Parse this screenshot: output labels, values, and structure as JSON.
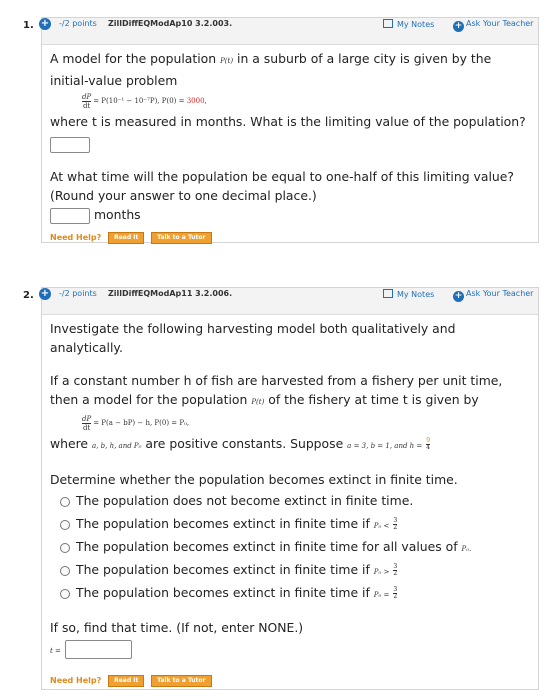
{
  "q1": {
    "number": "1.",
    "points": "-/2 points",
    "id": "ZillDiffEQModAp10 3.2.003.",
    "my_notes": "My Notes",
    "ask_teacher": "Ask Your Teacher",
    "intro_a": "A model for the population",
    "intro_pt": "P(t)",
    "intro_b": "in a suburb of a large city is given by the initial-value problem",
    "eq_num": "dP",
    "eq_den": "dt",
    "eq_body": "= P(10⁻¹ − 10⁻⁷P),   P(0) = ",
    "eq_initial": "3000",
    "eq_end": ",",
    "question1": "where t is measured in months. What is the limiting value of the population?",
    "question2": "At what time will the population be equal to one-half of this limiting value? (Round your answer to one decimal place.)",
    "unit": "months",
    "need_help": "Need Help?",
    "read_it": "Read It",
    "talk_tutor": "Talk to a Tutor"
  },
  "q2": {
    "number": "2.",
    "points": "-/2 points",
    "id": "ZillDiffEQModAp11 3.2.006.",
    "my_notes": "My Notes",
    "ask_teacher": "Ask Your Teacher",
    "intro": "Investigate the following harvesting model both qualitatively and analytically.",
    "para_a": "If a constant number h of fish are harvested from a fishery per unit time, then a model for the population",
    "para_pt": "P(t)",
    "para_b": "of the fishery at time t is given by",
    "eq_num": "dP",
    "eq_den": "dt",
    "eq_body": "= P(a − bP) − h,   P(0) = P₀,",
    "where_a": "where",
    "where_vars": "a, b, h, and P₀",
    "where_b": "are positive constants. Suppose",
    "suppose_vals": "a = 3, b = 1, and h =",
    "suppose_num": "9",
    "suppose_den": "4",
    "determine": "Determine whether the population becomes extinct in finite time.",
    "options": [
      {
        "label": "The population does not become extinct in finite time.",
        "cond": "",
        "num": "",
        "den": ""
      },
      {
        "label": "The population becomes extinct in finite time if",
        "cond": "P₀ <",
        "num": "3",
        "den": "2"
      },
      {
        "label": "The population becomes extinct in finite time for all values of",
        "cond": "P₀.",
        "num": "",
        "den": ""
      },
      {
        "label": "The population becomes extinct in finite time if",
        "cond": "P₀ >",
        "num": "3",
        "den": "2"
      },
      {
        "label": "The population becomes extinct in finite time if",
        "cond": "P₀ =",
        "num": "3",
        "den": "2"
      }
    ],
    "find_time": "If so, find that time. (If not, enter NONE.)",
    "t_label": "t =",
    "need_help": "Need Help?",
    "read_it": "Read It",
    "talk_tutor": "Talk to a Tutor"
  }
}
